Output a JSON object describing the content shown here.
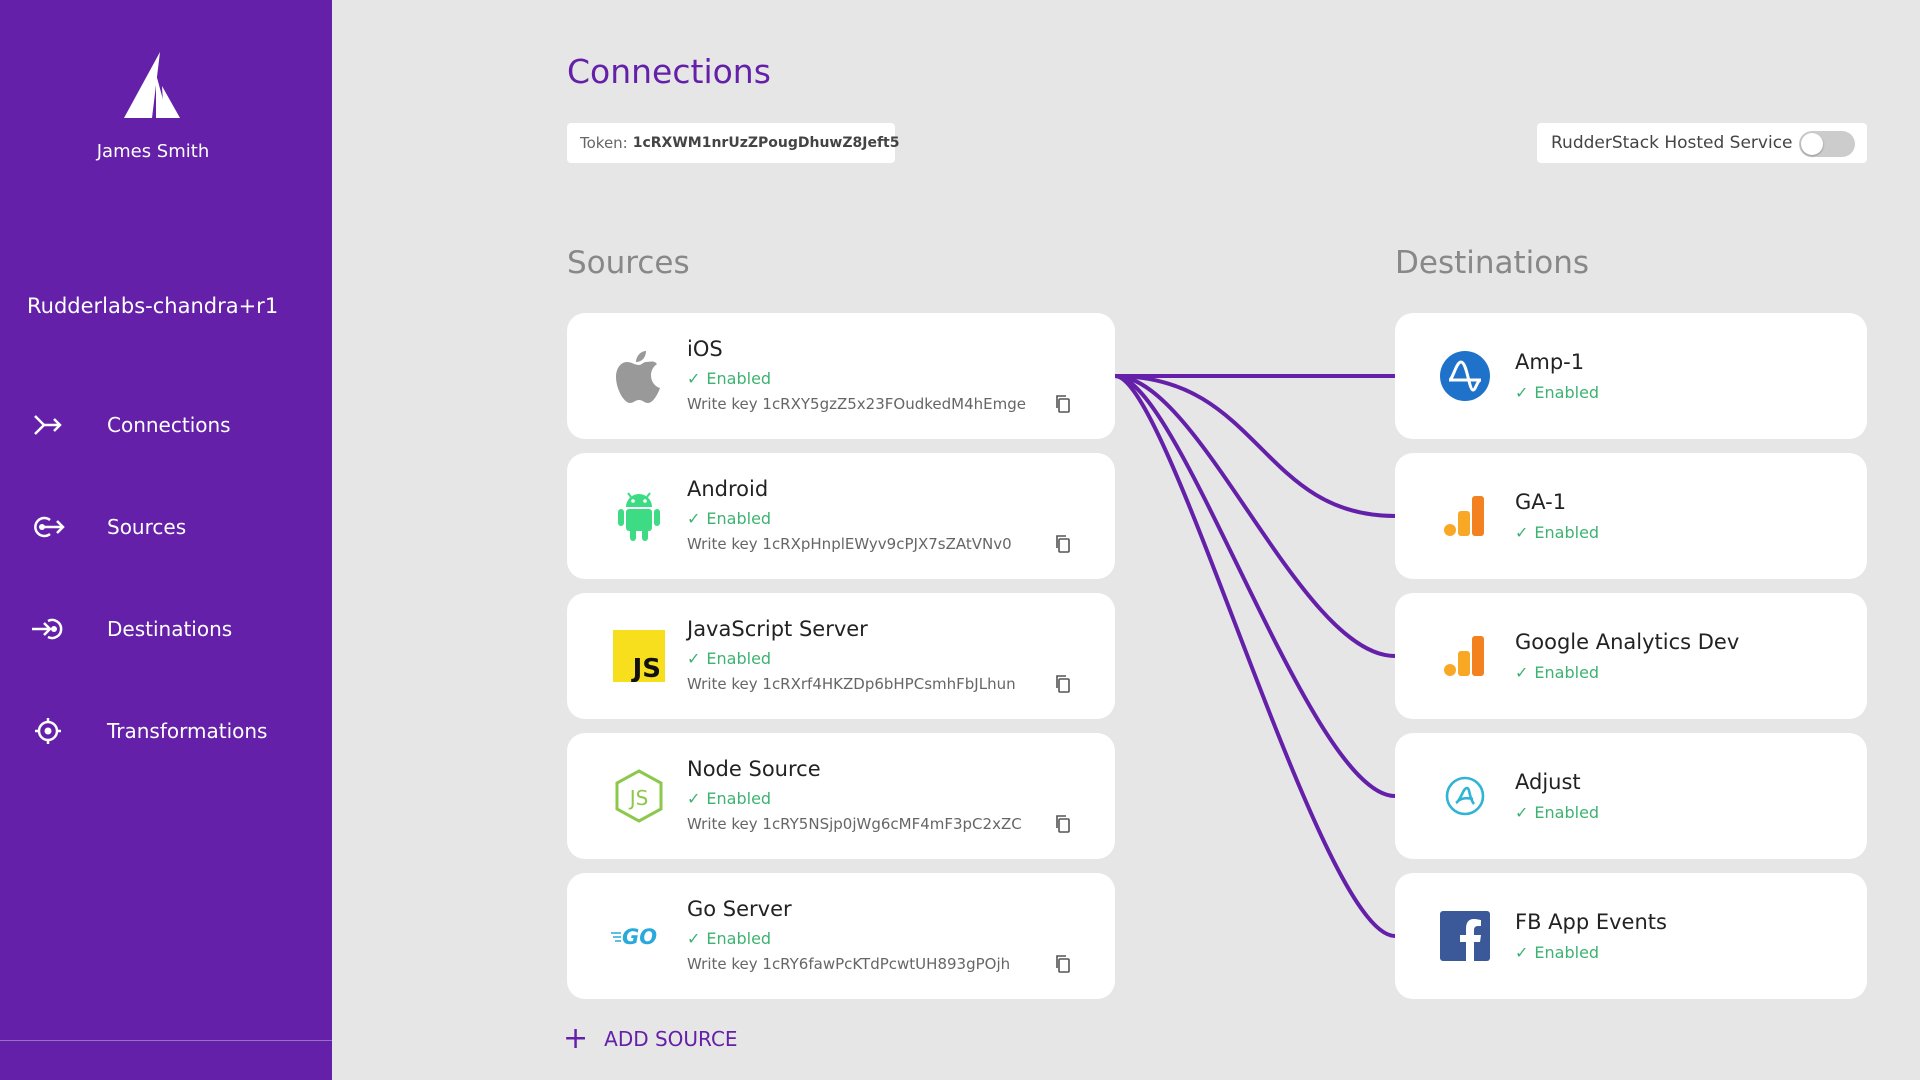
{
  "sidebar": {
    "user_name": "James Smith",
    "workspace": "Rudderlabs-chandra+r1",
    "nav": [
      {
        "label": "Connections",
        "icon": "connections-icon"
      },
      {
        "label": "Sources",
        "icon": "sources-icon"
      },
      {
        "label": "Destinations",
        "icon": "destinations-icon"
      },
      {
        "label": "Transformations",
        "icon": "transformations-icon"
      }
    ]
  },
  "header": {
    "title": "Connections",
    "token_label": "Token:",
    "token_value": "1cRXWM1nrUzZPougDhuwZ8Jeft5",
    "hosted_label": "RudderStack Hosted Service",
    "hosted_enabled": false
  },
  "sources": {
    "title": "Sources",
    "add_label": "ADD SOURCE",
    "items": [
      {
        "name": "iOS",
        "status": "Enabled",
        "write_key": "Write key 1cRXY5gzZ5x23FOudkedM4hEmge",
        "icon": "apple-icon"
      },
      {
        "name": "Android",
        "status": "Enabled",
        "write_key": "Write key 1cRXpHnplEWyv9cPJX7sZAtVNv0",
        "icon": "android-icon"
      },
      {
        "name": "JavaScript Server",
        "status": "Enabled",
        "write_key": "Write key 1cRXrf4HKZDp6bHPCsmhFbJLhun",
        "icon": "javascript-icon"
      },
      {
        "name": "Node Source",
        "status": "Enabled",
        "write_key": "Write key 1cRY5NSjp0jWg6cMF4mF3pC2xZC",
        "icon": "nodejs-icon"
      },
      {
        "name": "Go Server",
        "status": "Enabled",
        "write_key": "Write key 1cRY6fawPcKTdPcwtUH893gPOjh",
        "icon": "go-icon"
      }
    ]
  },
  "destinations": {
    "title": "Destinations",
    "items": [
      {
        "name": "Amp-1",
        "status": "Enabled",
        "icon": "amplitude-icon"
      },
      {
        "name": "GA-1",
        "status": "Enabled",
        "icon": "google-analytics-icon"
      },
      {
        "name": "Google Analytics Dev",
        "status": "Enabled",
        "icon": "google-analytics-icon"
      },
      {
        "name": "Adjust",
        "status": "Enabled",
        "icon": "adjust-icon"
      },
      {
        "name": "FB App Events",
        "status": "Enabled",
        "icon": "facebook-icon"
      }
    ]
  },
  "colors": {
    "brand": "#6420a9",
    "enabled": "#3cb371",
    "background": "#e6e6e6"
  }
}
